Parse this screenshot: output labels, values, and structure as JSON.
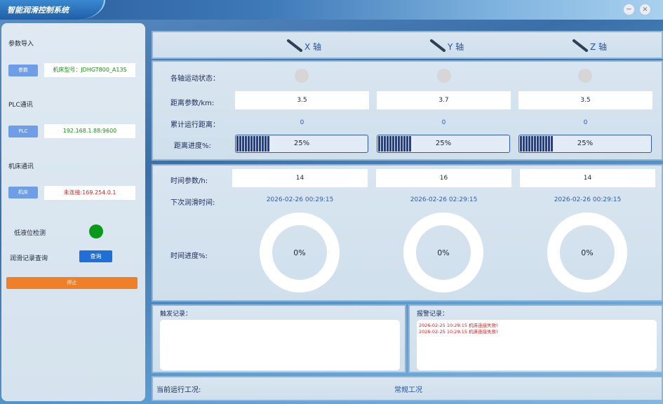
{
  "app": {
    "title": "智能润滑控制系统"
  },
  "window_controls": {
    "minimize": "−",
    "close": "×"
  },
  "left": {
    "param_import_label": "参数导入",
    "param_button": "参数",
    "machine_model": "机床型号：JDHGT800_A13S",
    "plc_label": "PLC通讯",
    "plc_button": "PLC",
    "plc_address": "192.168.1.88:9600",
    "machine_comm_label": "机床通讯",
    "machine_button": "机床",
    "machine_status": "未连接:169.254.0.1",
    "low_level_label": "低液位检测",
    "low_level_color": "#0a9a1a",
    "log_query_label": "润滑记录查询",
    "query_button": "查询",
    "stop_button": "停止"
  },
  "axes": [
    {
      "name": "X 轴",
      "distance_param": "3.5",
      "cumulative_distance": "0",
      "distance_progress": "25%",
      "distance_progress_value": 0.25,
      "time_param": "14",
      "next_lube_time": "2026-02-26 00:29:15",
      "time_progress": "0%"
    },
    {
      "name": "Y 轴",
      "distance_param": "3.7",
      "cumulative_distance": "0",
      "distance_progress": "25%",
      "distance_progress_value": 0.25,
      "time_param": "16",
      "next_lube_time": "2026-02-26 02:29:15",
      "time_progress": "0%"
    },
    {
      "name": "Z 轴",
      "distance_param": "3.5",
      "cumulative_distance": "0",
      "distance_progress": "25%",
      "distance_progress_value": 0.25,
      "time_param": "14",
      "next_lube_time": "2026-02-26 00:29:15",
      "time_progress": "0%"
    }
  ],
  "rows": {
    "motion_status": "各轴运动状态：",
    "distance_param": "距离参数/km:",
    "cumulative_distance": "累计运行距离：",
    "distance_progress": "距离进度%:",
    "time_param": "时间参数/h:",
    "next_lube_time": "下次润滑时间:",
    "time_progress": "时间进度%:"
  },
  "logs": {
    "trigger_label": "触发记录：",
    "trigger_entries": [],
    "alarm_label": "报警记录：",
    "alarm_entries": [
      "2026-02-25 10:29:15 机床连接失败!",
      "2026-02-25 10:29:15 机床连接失败!"
    ]
  },
  "status_bar": {
    "label": "当前运行工况:",
    "value": "常规工况"
  }
}
